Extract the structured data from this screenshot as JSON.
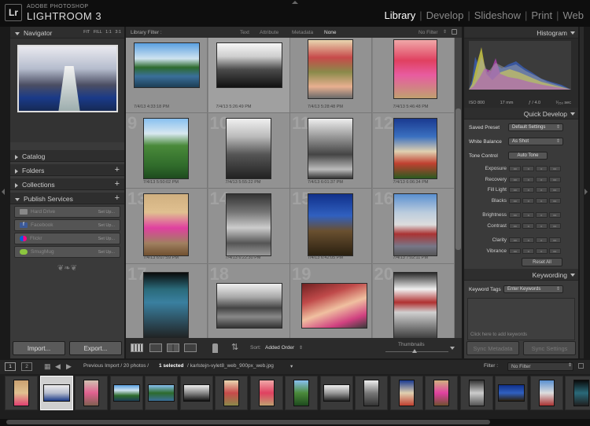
{
  "app": {
    "logo": "Lr",
    "brand_top": "ADOBE PHOTOSHOP",
    "brand_name": "LIGHTROOM 3",
    "modules": [
      "Library",
      "Develop",
      "Slideshow",
      "Print",
      "Web"
    ],
    "active_module": "Library"
  },
  "left_panel": {
    "navigator": {
      "title": "Navigator",
      "zoom": [
        "FIT",
        "FILL",
        "1:1",
        "3:1"
      ]
    },
    "sections": [
      {
        "title": "Catalog",
        "plus": ""
      },
      {
        "title": "Folders",
        "plus": "+"
      },
      {
        "title": "Collections",
        "plus": "+"
      },
      {
        "title": "Publish Services",
        "plus": "+"
      }
    ],
    "services": [
      {
        "name": "Hard Drive",
        "setup": "Set Up...",
        "color": "#888888"
      },
      {
        "name": "Facebook",
        "setup": "Set Up...",
        "color": "#3b5998"
      },
      {
        "name": "Flickr",
        "setup": "Set Up...",
        "color": "#ff0084"
      },
      {
        "name": "SmugMug",
        "setup": "Set Up...",
        "color": "#8cc63f"
      }
    ],
    "ornament": "❦❧❦",
    "import_label": "Import...",
    "export_label": "Export..."
  },
  "filter_bar": {
    "label": "Library Filter :",
    "options": [
      "Text",
      "Attribute",
      "Metadata",
      "None"
    ],
    "active": "None",
    "preset": "No Filter"
  },
  "grid": {
    "rows": [
      [
        {
          "num": "",
          "ts": "7/4/13 4:33:18 PM"
        },
        {
          "num": "",
          "ts": "7/4/13 5:26:49 PM"
        },
        {
          "num": "",
          "ts": "7/4/13 5:28:48 PM"
        },
        {
          "num": "",
          "ts": "7/4/13 5:46:48 PM"
        }
      ],
      [
        {
          "num": "9",
          "ts": "7/4/13 5:50:02 PM"
        },
        {
          "num": "10",
          "ts": "7/4/13 5:55:22 PM"
        },
        {
          "num": "11",
          "ts": "7/4/13 6:01:37 PM"
        },
        {
          "num": "12",
          "ts": "7/4/13 6:06:34 PM"
        }
      ],
      [
        {
          "num": "13",
          "ts": "7/4/13 6:07:59 PM"
        },
        {
          "num": "14",
          "ts": "7/4/13 6:22:30 PM"
        },
        {
          "num": "15",
          "ts": "7/4/13 6:42:05 PM"
        },
        {
          "num": "16",
          "ts": "7/4/13 7:02:11 PM"
        }
      ],
      [
        {
          "num": "17",
          "ts": ""
        },
        {
          "num": "18",
          "ts": ""
        },
        {
          "num": "19",
          "ts": ""
        },
        {
          "num": "20",
          "ts": ""
        }
      ]
    ]
  },
  "toolbar": {
    "sort_label": "Sort:",
    "sort_value": "Added Order",
    "thumbnails_label": "Thumbnails"
  },
  "right_panel": {
    "histogram": {
      "title": "Histogram",
      "iso": "ISO 800",
      "focal": "17 mm",
      "aperture": "ƒ / 4.0",
      "shutter": "¹⁄₂₅₀ sec"
    },
    "quick_develop": {
      "title": "Quick Develop",
      "saved_preset_label": "Saved Preset",
      "saved_preset_value": "Default Settings",
      "white_balance_label": "White Balance",
      "white_balance_value": "As Shot",
      "tone_control_label": "Tone Control",
      "auto_tone_label": "Auto Tone",
      "adjustments": [
        "Exposure",
        "Recovery",
        "Fill Light",
        "Blacks",
        "Brightness",
        "Contrast",
        "Clarity",
        "Vibrance"
      ],
      "step_buttons": [
        "◂◂",
        "◂",
        "▸",
        "▸▸"
      ],
      "reset_label": "Reset All"
    },
    "keywording": {
      "title": "Keywording",
      "tags_label": "Keyword Tags",
      "tags_value": "Enter Keywords",
      "add_hint": "Click here to add keywords"
    },
    "sync_metadata_label": "Sync Metadata",
    "sync_settings_label": "Sync Settings"
  },
  "filmstrip": {
    "view_numbers": [
      "1",
      "2"
    ],
    "path_prefix": "Previous Import / 20 photos /",
    "selected": "1 selected",
    "filename": "/ karlstejn-vylet8_web_900px_web.jpg",
    "filter_label": "Filter :",
    "filter_value": "No Filter"
  }
}
